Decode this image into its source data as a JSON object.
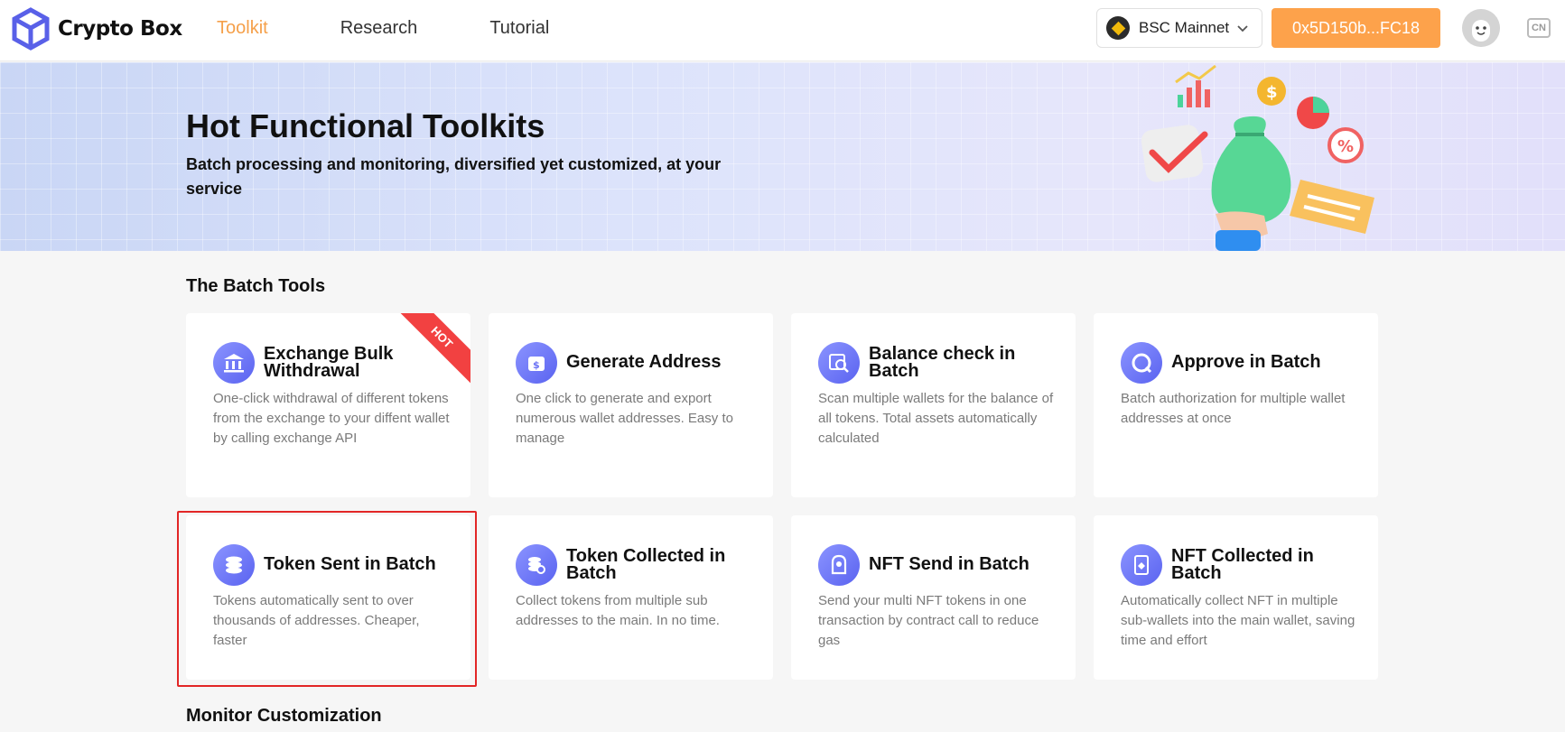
{
  "header": {
    "logo_text": "Crypto Box",
    "nav": [
      {
        "label": "Toolkit",
        "active": true
      },
      {
        "label": "Research",
        "active": false
      },
      {
        "label": "Tutorial",
        "active": false
      }
    ],
    "network_label": "BSC Mainnet",
    "wallet_address": "0x5D150b...FC18",
    "lang_label": "CN"
  },
  "banner": {
    "title": "Hot Functional Toolkits",
    "subtitle": "Batch processing and monitoring, diversified yet customized, at your service"
  },
  "batch_tools": {
    "section_title": "The Batch Tools",
    "hot_label": "HOT",
    "cards": [
      {
        "title": "Exchange Bulk Withdrawal",
        "desc": "One-click withdrawal of different tokens from the exchange to your diffent wallet by calling exchange API",
        "icon": "bank-icon",
        "hot": true
      },
      {
        "title": "Generate Address",
        "desc": "One click to generate and export numerous wallet addresses. Easy to manage",
        "icon": "wallet-icon"
      },
      {
        "title": "Balance check in Batch",
        "desc": "Scan multiple wallets for the balance of all tokens. Total assets automatically calculated",
        "icon": "balance-scan-icon"
      },
      {
        "title": "Approve in Batch",
        "desc": "Batch authorization for multiple wallet addresses at once",
        "icon": "approve-icon"
      },
      {
        "title": "Token Sent in Batch",
        "desc": "Tokens automatically sent to over thousands of addresses. Cheaper, faster",
        "icon": "coins-send-icon",
        "selected": true
      },
      {
        "title": "Token Collected in Batch",
        "desc": "Collect tokens from multiple sub addresses to the main. In no time.",
        "icon": "coins-collect-icon"
      },
      {
        "title": "NFT Send in Batch",
        "desc": "Send your multi NFT tokens in one transaction by contract call to reduce gas",
        "icon": "nft-send-icon"
      },
      {
        "title": "NFT Collected in Batch",
        "desc": "Automatically collect NFT in multiple sub-wallets into the main wallet, saving time and effort",
        "icon": "nft-collect-icon"
      }
    ]
  },
  "monitor": {
    "section_title": "Monitor Customization"
  },
  "colors": {
    "accent_orange": "#fda24b",
    "nav_active": "#f5a04a",
    "icon_purple": "#6a72f5",
    "hot_red": "#f24141",
    "selection_red": "#e22626"
  }
}
